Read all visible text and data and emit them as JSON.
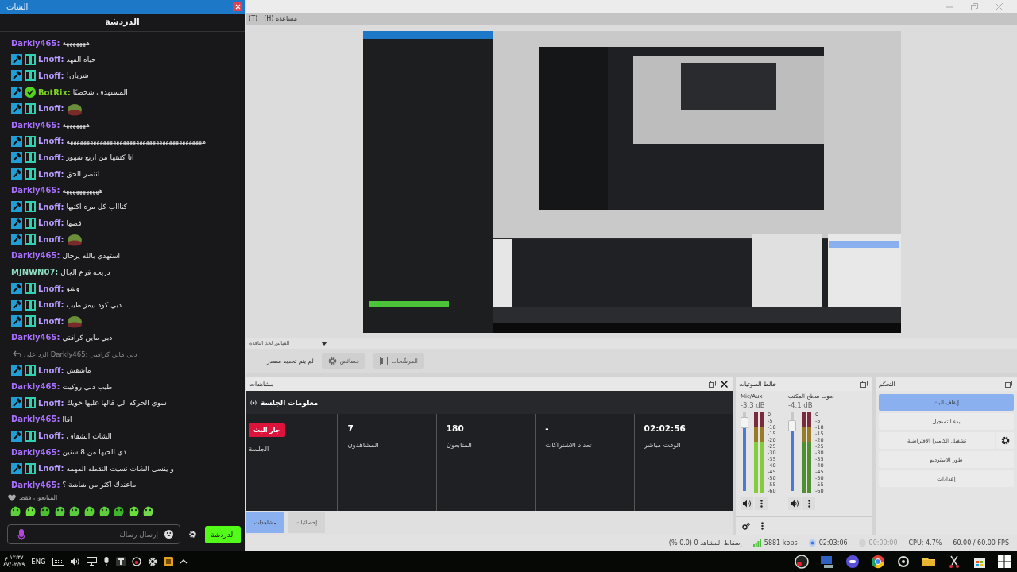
{
  "chat": {
    "window_title": "الشات",
    "header": "الدردشة",
    "messages": [
      {
        "kind": "text",
        "user": "Darkly465:",
        "color": "#a970ff",
        "mod": false,
        "og": false,
        "verified": false,
        "text": "هههههههه"
      },
      {
        "kind": "text",
        "user": "Lnoff:",
        "color": "#b89cff",
        "mod": true,
        "og": true,
        "verified": false,
        "text": "حياه الفهد"
      },
      {
        "kind": "text",
        "user": "Lnoff:",
        "color": "#b89cff",
        "mod": true,
        "og": true,
        "verified": false,
        "text": "شريان!"
      },
      {
        "kind": "text",
        "user": "BotRix:",
        "color": "#7ed321",
        "mod": true,
        "og": false,
        "verified": true,
        "text": "المستهدف شخصيًا"
      },
      {
        "kind": "emote",
        "user": "Lnoff:",
        "color": "#b89cff",
        "mod": true,
        "og": true,
        "verified": false
      },
      {
        "kind": "text",
        "user": "Darkly465:",
        "color": "#a970ff",
        "mod": false,
        "og": false,
        "verified": false,
        "text": "هههههههه"
      },
      {
        "kind": "text",
        "user": "Lnoff:",
        "color": "#b89cff",
        "mod": true,
        "og": true,
        "verified": false,
        "text": "هههههههههههههههههههههههههههههههههههههههههه"
      },
      {
        "kind": "text",
        "user": "Lnoff:",
        "color": "#b89cff",
        "mod": true,
        "og": true,
        "verified": false,
        "text": "انا كتبتها من اربع شهور"
      },
      {
        "kind": "text",
        "user": "Lnoff:",
        "color": "#b89cff",
        "mod": true,
        "og": true,
        "verified": false,
        "text": "انتصر الحق"
      },
      {
        "kind": "text",
        "user": "Darkly465:",
        "color": "#a970ff",
        "mod": false,
        "og": false,
        "verified": false,
        "text": "هههههههههههه"
      },
      {
        "kind": "text",
        "user": "Lnoff:",
        "color": "#b89cff",
        "mod": true,
        "og": true,
        "verified": false,
        "text": "كتاااب كل مره اكتبها"
      },
      {
        "kind": "text",
        "user": "Lnoff:",
        "color": "#b89cff",
        "mod": true,
        "og": true,
        "verified": false,
        "text": "قصها"
      },
      {
        "kind": "emote",
        "user": "Lnoff:",
        "color": "#b89cff",
        "mod": true,
        "og": true,
        "verified": false
      },
      {
        "kind": "text",
        "user": "Darkly465:",
        "color": "#a970ff",
        "mod": false,
        "og": false,
        "verified": false,
        "text": "استهدي بالله يرجال"
      },
      {
        "kind": "text",
        "user": "MJNWN07:",
        "color": "#8fdcc0",
        "mod": false,
        "og": false,
        "verified": false,
        "text": "دريحه فرع الجال"
      },
      {
        "kind": "text",
        "user": "Lnoff:",
        "color": "#b89cff",
        "mod": true,
        "og": true,
        "verified": false,
        "text": "وشو"
      },
      {
        "kind": "text",
        "user": "Lnoff:",
        "color": "#b89cff",
        "mod": true,
        "og": true,
        "verified": false,
        "text": "دبي كود نيمز طيب"
      },
      {
        "kind": "emote",
        "user": "Lnoff:",
        "color": "#b89cff",
        "mod": true,
        "og": true,
        "verified": false
      },
      {
        "kind": "text",
        "user": "Darkly465:",
        "color": "#a970ff",
        "mod": false,
        "og": false,
        "verified": false,
        "text": "دبي ماين كرافتي"
      },
      {
        "kind": "reply",
        "text": "الرد على Darkly465: دبي ماين كرافتي"
      },
      {
        "kind": "text",
        "user": "Lnoff:",
        "color": "#b89cff",
        "mod": true,
        "og": true,
        "verified": false,
        "text": "ماشفش"
      },
      {
        "kind": "text",
        "user": "Darkly465:",
        "color": "#a970ff",
        "mod": false,
        "og": false,
        "verified": false,
        "text": "طيب دبي روكيت"
      },
      {
        "kind": "text",
        "user": "Lnoff:",
        "color": "#b89cff",
        "mod": true,
        "og": true,
        "verified": false,
        "text": "سوي الحركه الي قالها عليها خويك"
      },
      {
        "kind": "text",
        "user": "Darkly465:",
        "color": "#a970ff",
        "mod": false,
        "og": false,
        "verified": false,
        "text": "اقاا"
      },
      {
        "kind": "text",
        "user": "Lnoff:",
        "color": "#b89cff",
        "mod": true,
        "og": true,
        "verified": false,
        "text": "الشات الشفاف"
      },
      {
        "kind": "text",
        "user": "Darkly465:",
        "color": "#a970ff",
        "mod": false,
        "og": false,
        "verified": false,
        "text": "ذي الحيها من 8 سنين"
      },
      {
        "kind": "text",
        "user": "Lnoff:",
        "color": "#b89cff",
        "mod": true,
        "og": true,
        "verified": false,
        "text": "و ينسى الشات نسيت النقطه المهمه"
      },
      {
        "kind": "text",
        "user": "Darkly465:",
        "color": "#a970ff",
        "mod": false,
        "og": false,
        "verified": false,
        "text": "ماعندك اكثر من شاشة ؟"
      }
    ],
    "followers_only": "المتابعون فقط",
    "input": {
      "placeholder": "إرسال رسالة"
    },
    "send_button": "الدردشة"
  },
  "obs": {
    "menu": [
      "مساعدة (H)",
      "(T)"
    ],
    "scale_dropdown": "القياس لحد النافذة",
    "source_buttons": [
      {
        "kind": "filters",
        "label": "المرشّحات"
      },
      {
        "kind": "properties",
        "label": "خصائص"
      }
    ],
    "source_label": "لم يتم تحديد مصدر",
    "stats_dock": {
      "title": "مشاهدات",
      "header": "معلومات الجلسة",
      "cells": [
        {
          "value": "02:02:56",
          "label": "الوقت مباشر"
        },
        {
          "value": "-",
          "label": "تعداد الاشتراكات"
        },
        {
          "value": "180",
          "label": "المتابعون"
        },
        {
          "value": "7",
          "label": "المشاهدون"
        },
        {
          "badge": "جار البث",
          "label": "الجلسة"
        }
      ],
      "tabs": [
        {
          "label": "إحصائيات",
          "selected": false
        },
        {
          "label": "مشاهدات",
          "selected": true
        }
      ]
    },
    "mixer": {
      "title": "خالط الصوتيات",
      "channels": [
        {
          "name": "صوت سطح المكتب",
          "reading": "-4.1 dB",
          "level": 0.82,
          "scale": [
            "0",
            "-5",
            "-10",
            "-15",
            "-20",
            "-25",
            "-30",
            "-35",
            "-40",
            "-45",
            "-50",
            "-55",
            "-60"
          ]
        },
        {
          "name": "Mic/Aux",
          "reading": "-3.3 dB",
          "level": 0.86,
          "scale": [
            "0",
            "-5",
            "-10",
            "-15",
            "-20",
            "-25",
            "-30",
            "-35",
            "-40",
            "-45",
            "-50",
            "-55",
            "-60"
          ]
        }
      ]
    },
    "controls": {
      "title": "التحكم",
      "buttons": [
        {
          "label": "إيقاف البث",
          "active": true,
          "kind": "plain"
        },
        {
          "label": "بدء التسجيل",
          "active": false,
          "kind": "plain"
        },
        {
          "label": "تشغيل الكاميرا الافتراضية",
          "active": false,
          "kind": "with-settings"
        },
        {
          "label": "طور الاستوديو",
          "active": false,
          "kind": "plain"
        },
        {
          "label": "إعدادات",
          "active": false,
          "kind": "plain"
        }
      ]
    },
    "status_bar": [
      "60.00 / 60.00 FPS",
      "CPU: 4.7%",
      "00:00:00",
      "02:03:06",
      "5881 kbps",
      "إسقاط المشاهد 0 (0.0 %)"
    ]
  },
  "taskbar": {
    "clock": "١٢:٣٧ م",
    "date": "٤٧/٠٢/٢٩",
    "language": "ENG"
  }
}
